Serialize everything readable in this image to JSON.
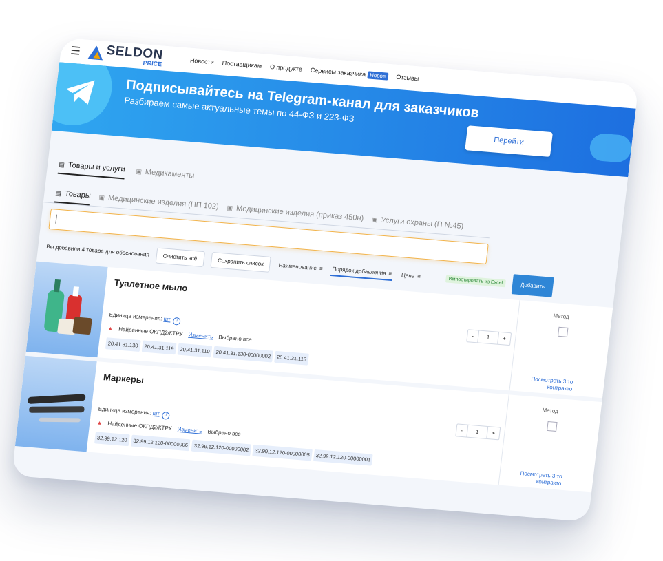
{
  "header": {
    "logo_main": "SELDON",
    "logo_sub": "PRICE",
    "nav": [
      "Новости",
      "Поставщикам",
      "О продукте",
      "Сервисы заказчика",
      "Отзывы"
    ],
    "badge": "Новое"
  },
  "banner": {
    "title": "Подписывайтесь на Telegram-канал для заказчиков",
    "subtitle": "Разбираем самые актуальные темы по 44-ФЗ и 223-ФЗ",
    "button": "Перейти"
  },
  "tabs_top": [
    {
      "label": "Товары и услуги",
      "active": true
    },
    {
      "label": "Медикаменты",
      "active": false
    }
  ],
  "tabs_sub": [
    {
      "label": "Товары",
      "active": true
    },
    {
      "label": "Медицинские изделия (ПП 102)",
      "active": false
    },
    {
      "label": "Медицинские изделия (приказ 450н)",
      "active": false
    },
    {
      "label": "Услуги охраны (П №45)",
      "active": false
    }
  ],
  "listbar": {
    "added_text": "Вы добавили 4 товара для обоснования",
    "clear": "Очистить всё",
    "save": "Сохранить список",
    "sort": [
      "Наименование",
      "Порядок добавления",
      "Цена"
    ],
    "excel": "Импортировать из Excel",
    "add": "Добавить"
  },
  "items": [
    {
      "title": "Туалетное мыло",
      "unit_label": "Единица измерения:",
      "unit": "шт",
      "qty": "1",
      "okpd_label": "Найденные ОКПД2/КТРУ",
      "change": "Изменить",
      "selected": "Выбрано все",
      "codes": [
        "20.41.31.130",
        "20.41.31.119",
        "20.41.31.110",
        "20.41.31.130-00000002",
        "20.41.31.113"
      ],
      "method": "Метод",
      "view_link": "Посмотреть 3 то контракто"
    },
    {
      "title": "Маркеры",
      "unit_label": "Единица измерения:",
      "unit": "шт",
      "qty": "1",
      "okpd_label": "Найденные ОКПД2/КТРУ",
      "change": "Изменить",
      "selected": "Выбрано все",
      "codes": [
        "32.99.12.120",
        "32.99.12.120-00000006",
        "32.99.12.120-00000002",
        "32.99.12.120-00000005",
        "32.99.12.120-00000001"
      ],
      "method": "Метод",
      "view_link": "Посмотреть 3 то контракто"
    }
  ]
}
